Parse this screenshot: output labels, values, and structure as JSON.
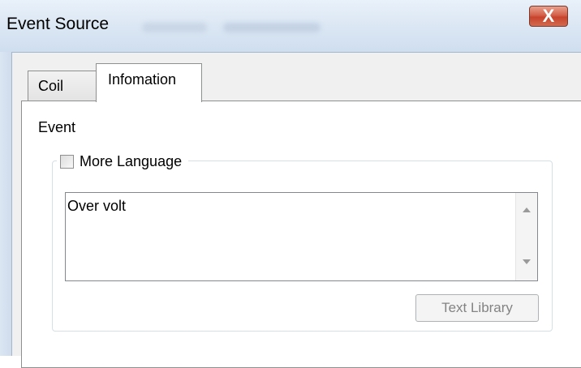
{
  "window": {
    "title": "Event Source",
    "close_symbol": "X"
  },
  "tabs": [
    {
      "label": "Coil",
      "active": false
    },
    {
      "label": "Infomation",
      "active": true
    }
  ],
  "panel": {
    "event_label": "Event",
    "more_language": {
      "label": "More Language",
      "checked": false
    },
    "event_text": "Over volt",
    "text_library_button": "Text Library"
  },
  "colors": {
    "close_button": "#c8432b",
    "titlebar": "#dae6f3",
    "panel_background": "#ffffff"
  }
}
